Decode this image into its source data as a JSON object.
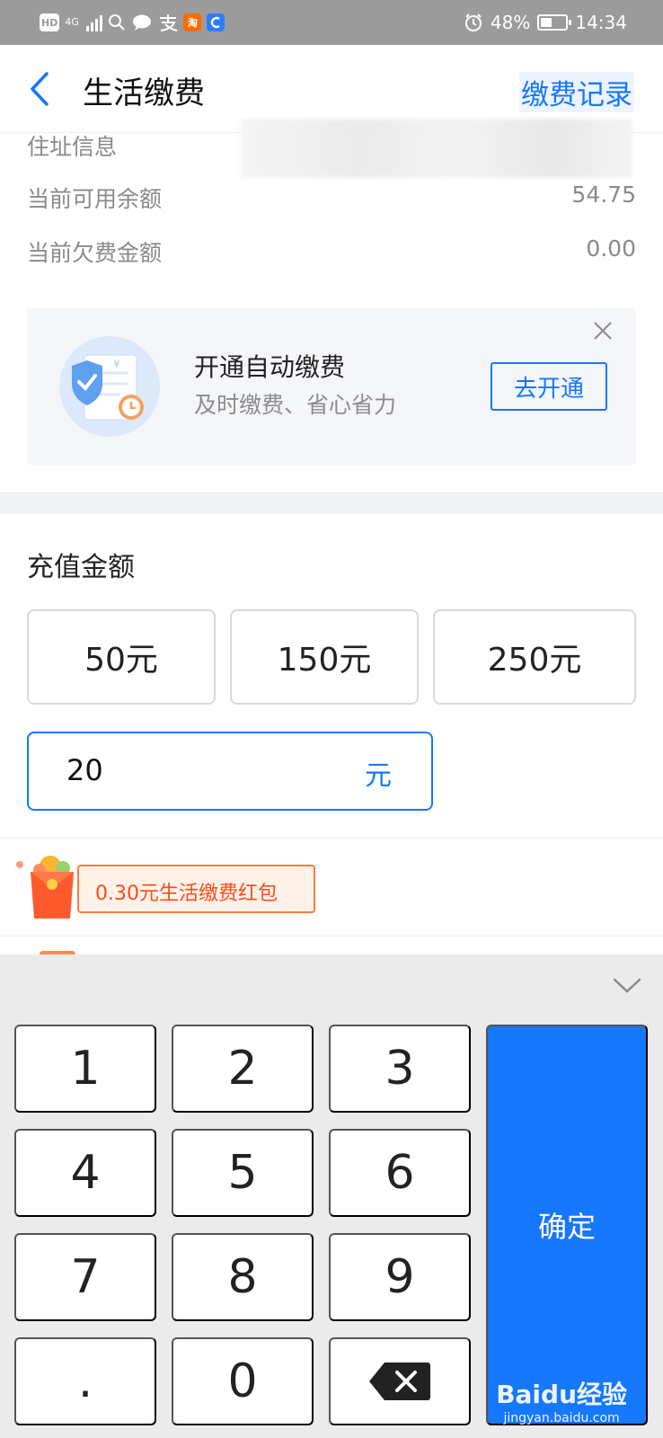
{
  "status_bar": {
    "hd": "HD",
    "network": "4G",
    "taobao": "淘",
    "battery_percent": "48%",
    "battery_level": 0.48,
    "time": "14:34"
  },
  "header": {
    "title": "生活缴费",
    "records_link": "缴费记录"
  },
  "info": {
    "address_label": "住址信息",
    "balance_label": "当前可用余额",
    "balance_value": "54.75",
    "arrears_label": "当前欠费金额",
    "arrears_value": "0.00"
  },
  "promo": {
    "title": "开通自动缴费",
    "subtitle": "及时缴费、省心省力",
    "button": "去开通"
  },
  "recharge": {
    "label": "充值金额",
    "options": [
      "50元",
      "150元",
      "250元"
    ],
    "input_value": "20",
    "input_unit": "元"
  },
  "red_packet": {
    "text": "0.30元生活缴费红包"
  },
  "keyboard": {
    "keys": [
      "1",
      "2",
      "3",
      "4",
      "5",
      "6",
      "7",
      "8",
      "9",
      ".",
      "0"
    ],
    "confirm": "确定"
  },
  "watermark": {
    "logo": "Baidu经验",
    "site": "jingyan.baidu.com"
  },
  "colors": {
    "accent": "#1677ff",
    "status_bar": "#9b9b9b",
    "red_packet": "#ff4a1c"
  }
}
